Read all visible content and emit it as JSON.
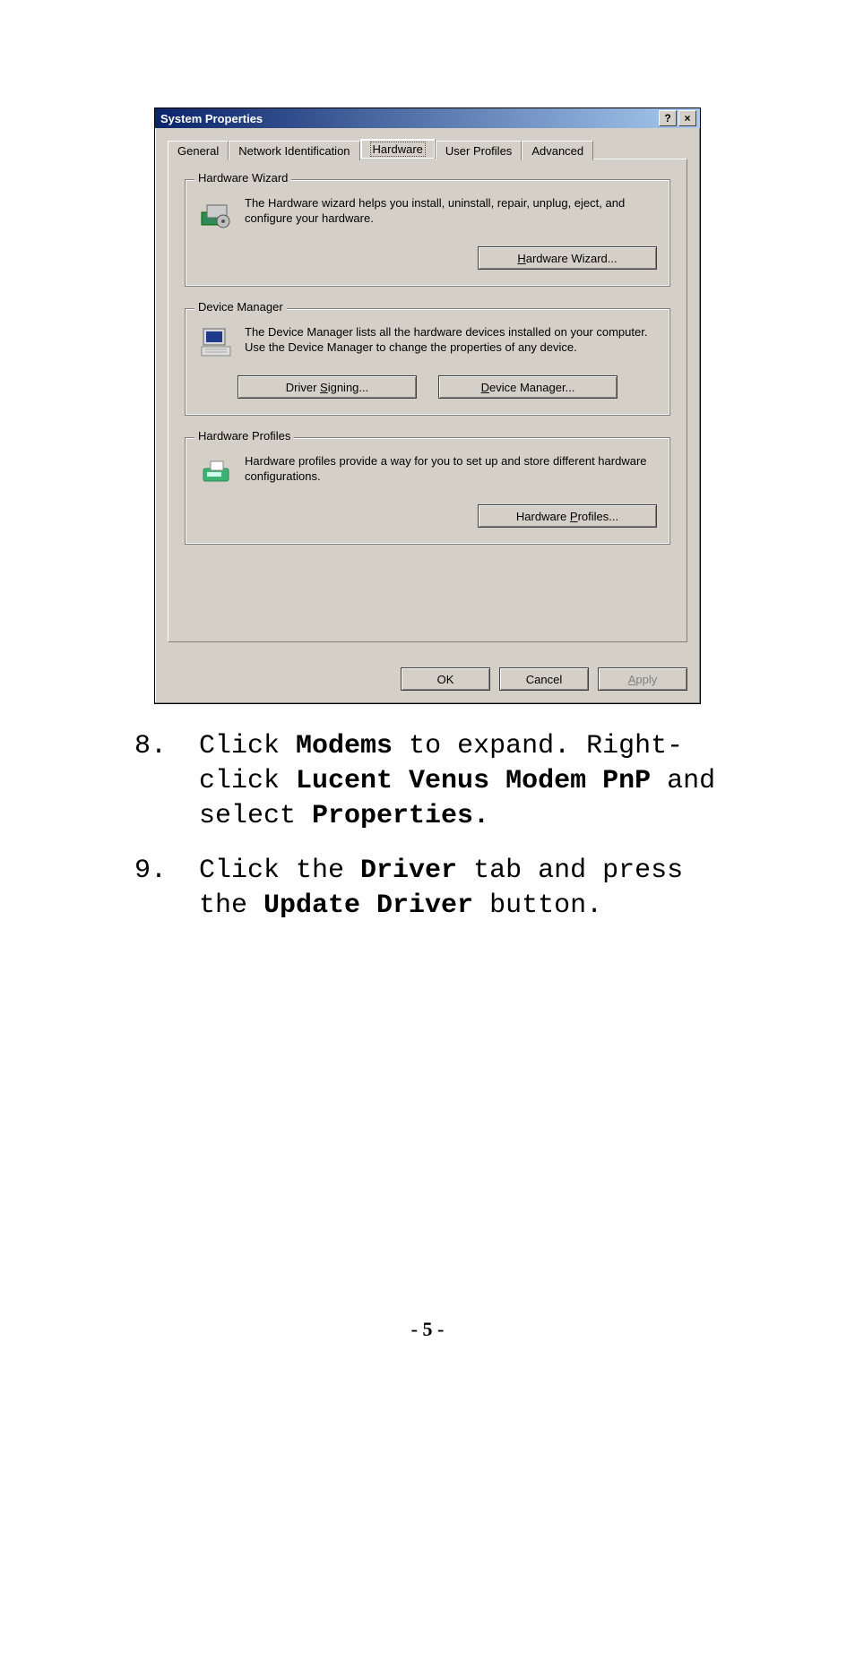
{
  "dialog": {
    "title": "System Properties",
    "help_glyph": "?",
    "close_glyph": "×",
    "tabs": [
      "General",
      "Network Identification",
      "Hardware",
      "User Profiles",
      "Advanced"
    ],
    "active_tab": "Hardware",
    "groups": {
      "wizard": {
        "legend": "Hardware Wizard",
        "text": "The Hardware wizard helps you install, uninstall, repair, unplug, eject, and configure your hardware.",
        "button_pre": "",
        "button_u": "H",
        "button_post": "ardware Wizard..."
      },
      "devmgr": {
        "legend": "Device Manager",
        "text": "The Device Manager lists all the hardware devices installed on your computer. Use the Device Manager to change the properties of any device.",
        "btn1_pre": "Driver ",
        "btn1_u": "S",
        "btn1_post": "igning...",
        "btn2_pre": "",
        "btn2_u": "D",
        "btn2_post": "evice Manager..."
      },
      "profiles": {
        "legend": "Hardware Profiles",
        "text": "Hardware profiles provide a way for you to set up and store different hardware configurations.",
        "button_pre": "Hardware ",
        "button_u": "P",
        "button_post": "rofiles..."
      }
    },
    "footer": {
      "ok": "OK",
      "cancel": "Cancel",
      "apply_u": "A",
      "apply_post": "pply"
    }
  },
  "instructions": {
    "step8_a": "Click ",
    "step8_b1": "Modems",
    "step8_c": " to expand. Right-click ",
    "step8_b2": "Lucent Venus Modem PnP",
    "step8_d": " and select ",
    "step8_b3": "Properties.",
    "step9_a": "Click the ",
    "step9_b1": "Driver",
    "step9_c": " tab and press the ",
    "step9_b2": "Update Driver",
    "step9_d": " button."
  },
  "page_number": "- 5 -"
}
